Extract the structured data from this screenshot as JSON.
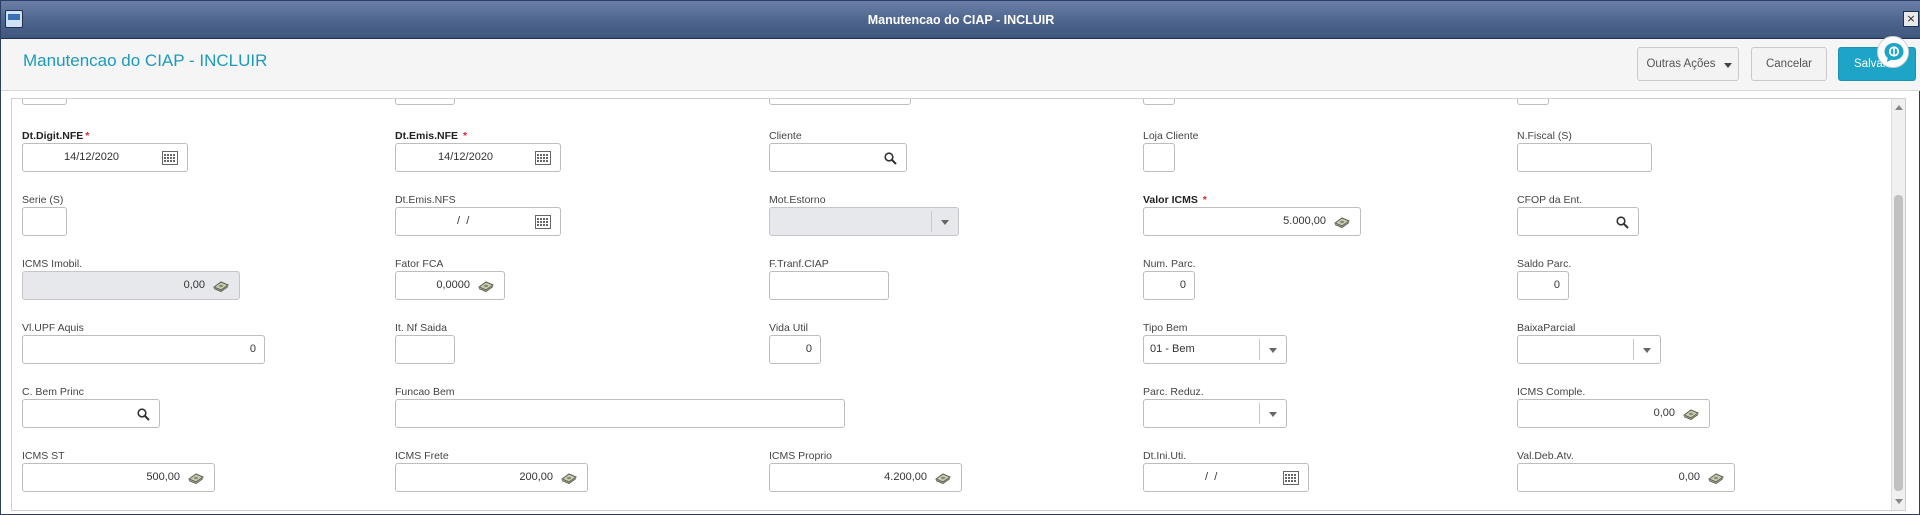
{
  "window": {
    "title": "Manutencao do CIAP - INCLUIR",
    "close_label": "×"
  },
  "header": {
    "page_title": "Manutencao do CIAP - INCLUIR",
    "btn_outras": "Outras Ações",
    "btn_cancelar": "Cancelar",
    "btn_salvar": "Salvar"
  },
  "colors": {
    "accent": "#1ea4c7",
    "required": "#d9272e",
    "titlebar": "#4f678f"
  },
  "form": {
    "dt_digit_nfe": {
      "label": "Dt.Digit.NFE",
      "value": "14/12/2020",
      "required": true
    },
    "dt_emis_nfe": {
      "label": "Dt.Emis.NFE",
      "value": "14/12/2020",
      "required": true
    },
    "cliente": {
      "label": "Cliente",
      "value": ""
    },
    "loja_cliente": {
      "label": "Loja Cliente",
      "value": ""
    },
    "n_fiscal_s": {
      "label": "N.Fiscal (S)",
      "value": ""
    },
    "serie_s": {
      "label": "Serie (S)",
      "value": ""
    },
    "dt_emis_nfs": {
      "label": "Dt.Emis.NFS",
      "value": " /  / "
    },
    "mot_estorno": {
      "label": "Mot.Estorno",
      "value": ""
    },
    "valor_icms": {
      "label": "Valor ICMS",
      "value": "5.000,00",
      "required": true
    },
    "cfop_ent": {
      "label": "CFOP da Ent.",
      "value": ""
    },
    "icms_imobil": {
      "label": "ICMS Imobil.",
      "value": "0,00"
    },
    "fator_fca": {
      "label": "Fator FCA",
      "value": "0,0000"
    },
    "f_tranf_ciap": {
      "label": "F.Tranf.CIAP",
      "value": ""
    },
    "num_parc": {
      "label": "Num. Parc.",
      "value": "0"
    },
    "saldo_parc": {
      "label": "Saldo Parc.",
      "value": "0"
    },
    "vl_upf_aquis": {
      "label": "Vl.UPF Aquis",
      "value": "0"
    },
    "it_nf_saida": {
      "label": "It. Nf Saida",
      "value": ""
    },
    "vida_util": {
      "label": "Vida Util",
      "value": "0"
    },
    "tipo_bem": {
      "label": "Tipo Bem",
      "value": "01 - Bem"
    },
    "baixa_parcial": {
      "label": "BaixaParcial",
      "value": ""
    },
    "c_bem_princ": {
      "label": "C. Bem Princ",
      "value": ""
    },
    "funcao_bem": {
      "label": "Funcao Bem",
      "value": ""
    },
    "parc_reduz": {
      "label": "Parc. Reduz.",
      "value": ""
    },
    "icms_comple": {
      "label": "ICMS Comple.",
      "value": "0,00"
    },
    "icms_st": {
      "label": "ICMS ST",
      "value": "500,00"
    },
    "icms_frete": {
      "label": "ICMS Frete",
      "value": "200,00"
    },
    "icms_proprio": {
      "label": "ICMS Proprio",
      "value": "4.200,00"
    },
    "dt_ini_uti": {
      "label": "Dt.Ini.Uti.",
      "value": " /  / "
    },
    "val_deb_atv": {
      "label": "Val.Deb.Atv.",
      "value": "0,00"
    }
  },
  "icons": {
    "calendar": "calendar-icon",
    "search": "search-icon",
    "money": "money-icon",
    "dropdown": "chevron-down-icon",
    "chat": "chat-icon"
  }
}
